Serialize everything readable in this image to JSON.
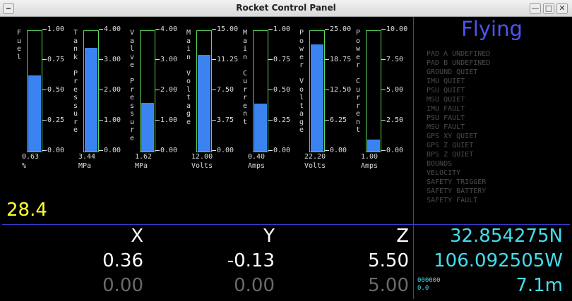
{
  "window": {
    "title": "Rocket Control Panel",
    "min_glyph": "—",
    "max_glyph": "□",
    "close_glyph": "✕"
  },
  "gauges": [
    {
      "label": "F\nu\ne\nl",
      "value_text": "0.63",
      "unit": "%",
      "fraction": 0.63,
      "ticks": [
        "1.00",
        "0.75",
        "0.50",
        "0.25",
        "0.00"
      ]
    },
    {
      "label": "T\na\nn\nk\n \nP\nr\ne\ns\ns\nu\nr\ne",
      "value_text": "3.44",
      "unit": "MPa",
      "fraction": 0.86,
      "ticks": [
        "4.00",
        "3.00",
        "2.00",
        "1.00",
        "0.00"
      ]
    },
    {
      "label": "V\na\nl\nv\ne\n \nP\nr\ne\ns\ns\nu\nr\ne",
      "value_text": "1.62",
      "unit": "MPa",
      "fraction": 0.405,
      "ticks": [
        "4.00",
        "3.00",
        "2.00",
        "1.00",
        "0.00"
      ]
    },
    {
      "label": "M\na\ni\nn\n \nV\no\nl\nt\na\ng\ne",
      "value_text": "12.00",
      "unit": "Volts",
      "fraction": 0.8,
      "ticks": [
        "15.00",
        "11.25",
        "7.50",
        "3.75",
        "0.00"
      ]
    },
    {
      "label": "M\na\ni\nn\n \nC\nu\nr\nr\ne\nn\nt",
      "value_text": "0.40",
      "unit": "Amps",
      "fraction": 0.4,
      "ticks": [
        "1.00",
        "0.75",
        "0.50",
        "0.25",
        "0.00"
      ]
    },
    {
      "label": "P\no\nw\ne\nr\n \nV\no\nl\nt\na\ng\ne",
      "value_text": "22.20",
      "unit": "Volts",
      "fraction": 0.888,
      "ticks": [
        "25.00",
        "18.75",
        "12.50",
        "6.25",
        "0.00"
      ]
    },
    {
      "label": "P\no\nw\ne\nr\n \nC\nu\nr\nr\ne\nn\nt",
      "value_text": "1.00",
      "unit": "Amps",
      "fraction": 0.1,
      "ticks": [
        "10.00",
        "7.50",
        "5.00",
        "2.50",
        "0.00"
      ]
    }
  ],
  "timer": "28.4",
  "status": {
    "state": "Flying",
    "flags": [
      "PAD A UNDEFINED",
      "PAD B UNDEFINED",
      "GROUND QUIET",
      "IMU QUIET",
      "PSU QUIET",
      "MSU QUIET",
      "IMU FAULT",
      "PSU FAULT",
      "MSU FAULT",
      "GPS XY QUIET",
      "GPS Z QUIET",
      "BPS Z QUIET",
      "BOUNDS",
      "VELOCITY",
      "SAFETY TRIGGER",
      "SAFETY BATTERY",
      "SAFETY FAULT"
    ]
  },
  "position": {
    "axes": [
      "X",
      "Y",
      "Z"
    ],
    "current": [
      "0.36",
      "-0.13",
      "5.50"
    ],
    "reference": [
      "0.00",
      "0.00",
      "5.00"
    ]
  },
  "gps": {
    "latitude": "32.854275N",
    "longitude": "106.092505W",
    "altitude": "7.1m",
    "small_line1": "000000",
    "small_line2": "0.0"
  },
  "colors": {
    "bar_fill": "#3b83f1",
    "bar_border": "#5cd65c",
    "timer": "#ffff33",
    "state": "#4b55f0",
    "gps": "#44ddee",
    "flag_inactive": "#4a4a4a"
  }
}
